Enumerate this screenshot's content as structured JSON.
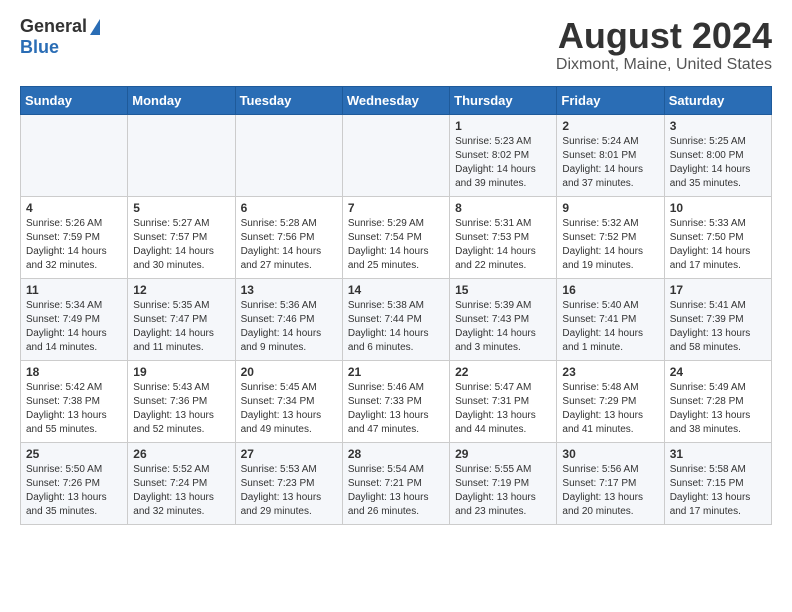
{
  "header": {
    "logo_general": "General",
    "logo_blue": "Blue",
    "month_title": "August 2024",
    "location": "Dixmont, Maine, United States"
  },
  "calendar": {
    "days_of_week": [
      "Sunday",
      "Monday",
      "Tuesday",
      "Wednesday",
      "Thursday",
      "Friday",
      "Saturday"
    ],
    "weeks": [
      [
        {
          "day": "",
          "info": ""
        },
        {
          "day": "",
          "info": ""
        },
        {
          "day": "",
          "info": ""
        },
        {
          "day": "",
          "info": ""
        },
        {
          "day": "1",
          "info": "Sunrise: 5:23 AM\nSunset: 8:02 PM\nDaylight: 14 hours\nand 39 minutes."
        },
        {
          "day": "2",
          "info": "Sunrise: 5:24 AM\nSunset: 8:01 PM\nDaylight: 14 hours\nand 37 minutes."
        },
        {
          "day": "3",
          "info": "Sunrise: 5:25 AM\nSunset: 8:00 PM\nDaylight: 14 hours\nand 35 minutes."
        }
      ],
      [
        {
          "day": "4",
          "info": "Sunrise: 5:26 AM\nSunset: 7:59 PM\nDaylight: 14 hours\nand 32 minutes."
        },
        {
          "day": "5",
          "info": "Sunrise: 5:27 AM\nSunset: 7:57 PM\nDaylight: 14 hours\nand 30 minutes."
        },
        {
          "day": "6",
          "info": "Sunrise: 5:28 AM\nSunset: 7:56 PM\nDaylight: 14 hours\nand 27 minutes."
        },
        {
          "day": "7",
          "info": "Sunrise: 5:29 AM\nSunset: 7:54 PM\nDaylight: 14 hours\nand 25 minutes."
        },
        {
          "day": "8",
          "info": "Sunrise: 5:31 AM\nSunset: 7:53 PM\nDaylight: 14 hours\nand 22 minutes."
        },
        {
          "day": "9",
          "info": "Sunrise: 5:32 AM\nSunset: 7:52 PM\nDaylight: 14 hours\nand 19 minutes."
        },
        {
          "day": "10",
          "info": "Sunrise: 5:33 AM\nSunset: 7:50 PM\nDaylight: 14 hours\nand 17 minutes."
        }
      ],
      [
        {
          "day": "11",
          "info": "Sunrise: 5:34 AM\nSunset: 7:49 PM\nDaylight: 14 hours\nand 14 minutes."
        },
        {
          "day": "12",
          "info": "Sunrise: 5:35 AM\nSunset: 7:47 PM\nDaylight: 14 hours\nand 11 minutes."
        },
        {
          "day": "13",
          "info": "Sunrise: 5:36 AM\nSunset: 7:46 PM\nDaylight: 14 hours\nand 9 minutes."
        },
        {
          "day": "14",
          "info": "Sunrise: 5:38 AM\nSunset: 7:44 PM\nDaylight: 14 hours\nand 6 minutes."
        },
        {
          "day": "15",
          "info": "Sunrise: 5:39 AM\nSunset: 7:43 PM\nDaylight: 14 hours\nand 3 minutes."
        },
        {
          "day": "16",
          "info": "Sunrise: 5:40 AM\nSunset: 7:41 PM\nDaylight: 14 hours\nand 1 minute."
        },
        {
          "day": "17",
          "info": "Sunrise: 5:41 AM\nSunset: 7:39 PM\nDaylight: 13 hours\nand 58 minutes."
        }
      ],
      [
        {
          "day": "18",
          "info": "Sunrise: 5:42 AM\nSunset: 7:38 PM\nDaylight: 13 hours\nand 55 minutes."
        },
        {
          "day": "19",
          "info": "Sunrise: 5:43 AM\nSunset: 7:36 PM\nDaylight: 13 hours\nand 52 minutes."
        },
        {
          "day": "20",
          "info": "Sunrise: 5:45 AM\nSunset: 7:34 PM\nDaylight: 13 hours\nand 49 minutes."
        },
        {
          "day": "21",
          "info": "Sunrise: 5:46 AM\nSunset: 7:33 PM\nDaylight: 13 hours\nand 47 minutes."
        },
        {
          "day": "22",
          "info": "Sunrise: 5:47 AM\nSunset: 7:31 PM\nDaylight: 13 hours\nand 44 minutes."
        },
        {
          "day": "23",
          "info": "Sunrise: 5:48 AM\nSunset: 7:29 PM\nDaylight: 13 hours\nand 41 minutes."
        },
        {
          "day": "24",
          "info": "Sunrise: 5:49 AM\nSunset: 7:28 PM\nDaylight: 13 hours\nand 38 minutes."
        }
      ],
      [
        {
          "day": "25",
          "info": "Sunrise: 5:50 AM\nSunset: 7:26 PM\nDaylight: 13 hours\nand 35 minutes."
        },
        {
          "day": "26",
          "info": "Sunrise: 5:52 AM\nSunset: 7:24 PM\nDaylight: 13 hours\nand 32 minutes."
        },
        {
          "day": "27",
          "info": "Sunrise: 5:53 AM\nSunset: 7:23 PM\nDaylight: 13 hours\nand 29 minutes."
        },
        {
          "day": "28",
          "info": "Sunrise: 5:54 AM\nSunset: 7:21 PM\nDaylight: 13 hours\nand 26 minutes."
        },
        {
          "day": "29",
          "info": "Sunrise: 5:55 AM\nSunset: 7:19 PM\nDaylight: 13 hours\nand 23 minutes."
        },
        {
          "day": "30",
          "info": "Sunrise: 5:56 AM\nSunset: 7:17 PM\nDaylight: 13 hours\nand 20 minutes."
        },
        {
          "day": "31",
          "info": "Sunrise: 5:58 AM\nSunset: 7:15 PM\nDaylight: 13 hours\nand 17 minutes."
        }
      ]
    ]
  }
}
